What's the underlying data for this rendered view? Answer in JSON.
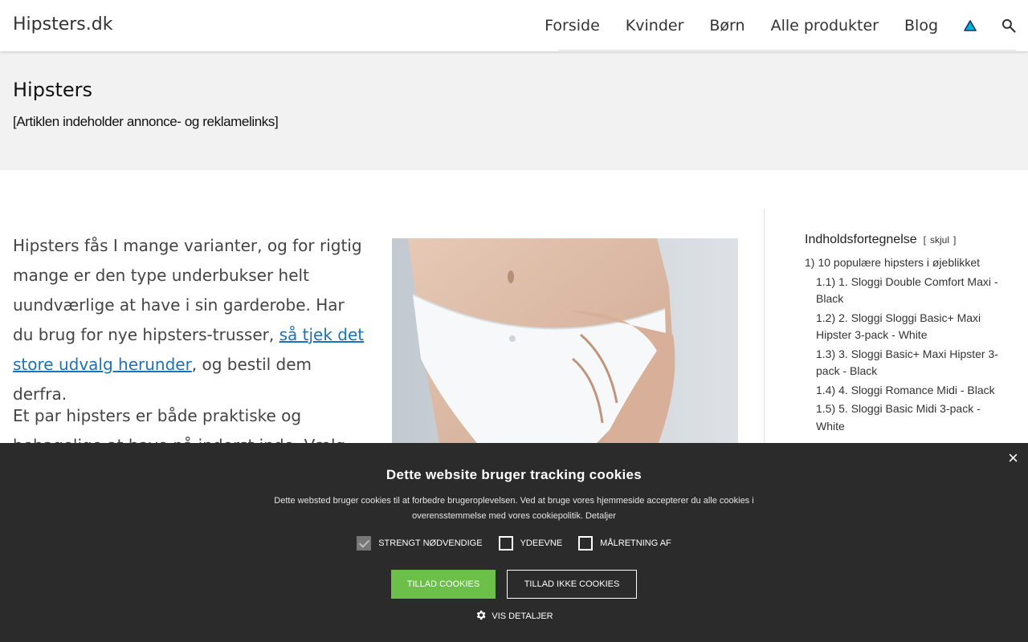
{
  "header": {
    "logo": "Hipsters.dk",
    "nav": [
      "Forside",
      "Kvinder",
      "Børn",
      "Alle produkter",
      "Blog"
    ],
    "icons": {
      "alert": "warning-triangle-icon",
      "search": "search-icon"
    },
    "alert_icon_color": "#00b4d8"
  },
  "hero": {
    "title": "Hipsters",
    "note": "[Artiklen indeholder annonce- og reklamelinks]"
  },
  "main": {
    "intro_before_link": "Hipsters fås I mange varianter, og for rigtig mange er den type underbukser helt uundværlige at have i sin garderobe. Har du brug for nye hipsters-trusser, ",
    "intro_link": "så tjek det store udvalg herunder",
    "intro_after_link": ", og bestil dem derfra.",
    "intro2": "Et par hipsters er både praktiske og behagelige at have på inderst inde. Vælg det eller de par",
    "link_color": "#1a73b8"
  },
  "toc": {
    "title": "Indholdsfortegnelse",
    "toggle": "skjul",
    "items": [
      {
        "num": "1)",
        "label": "10 populære hipsters i øjeblikket",
        "sub": false
      },
      {
        "num": "1.1)",
        "label": "1. Sloggi Double Comfort Maxi - Black",
        "sub": true
      },
      {
        "num": "1.2)",
        "label": "2. Sloggi Sloggi Basic+ Maxi Hipster 3-pack - White",
        "sub": true
      },
      {
        "num": "1.3)",
        "label": "3. Sloggi Basic+ Maxi Hipster 3-pack - Black",
        "sub": true
      },
      {
        "num": "1.4)",
        "label": "4. Sloggi Romance Midi - Black",
        "sub": true
      },
      {
        "num": "1.5)",
        "label": "5. Sloggi Basic Midi 3-pack - White",
        "sub": true
      }
    ]
  },
  "cookie": {
    "close": "×",
    "title": "Dette website bruger tracking cookies",
    "text": "Dette websted bruger cookies til at forbedre brugeroplevelsen. Ved at bruge vores hjemmeside accepterer du alle cookies i overensstemmelse med vores cookiepolitik.",
    "details_link": "Detaljer",
    "options": [
      {
        "label": "STRENGT NØDVENDIGE",
        "checked": true
      },
      {
        "label": "YDEEVNE",
        "checked": false
      },
      {
        "label": "MÅLRETNING AF",
        "checked": false
      }
    ],
    "allow": "TILLAD COOKIES",
    "deny": "TILLAD IKKE COOKIES",
    "show_details": "VIS DETALJER",
    "allow_color": "#6cc04a",
    "background": "#2b2b2b"
  }
}
